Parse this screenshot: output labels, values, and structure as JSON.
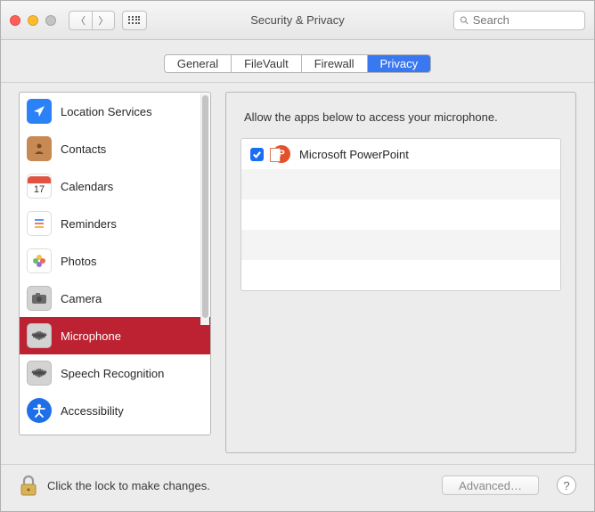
{
  "window": {
    "title": "Security & Privacy"
  },
  "search": {
    "placeholder": "Search",
    "value": ""
  },
  "tabs": [
    {
      "label": "General"
    },
    {
      "label": "FileVault"
    },
    {
      "label": "Firewall"
    },
    {
      "label": "Privacy",
      "active": true
    }
  ],
  "sidebar": {
    "items": [
      {
        "label": "Location Services",
        "icon": "location-icon"
      },
      {
        "label": "Contacts",
        "icon": "contacts-icon"
      },
      {
        "label": "Calendars",
        "icon": "calendar-icon",
        "calendar_day": "17"
      },
      {
        "label": "Reminders",
        "icon": "reminders-icon"
      },
      {
        "label": "Photos",
        "icon": "photos-icon"
      },
      {
        "label": "Camera",
        "icon": "camera-icon"
      },
      {
        "label": "Microphone",
        "icon": "microphone-icon",
        "selected": true
      },
      {
        "label": "Speech Recognition",
        "icon": "speech-icon"
      },
      {
        "label": "Accessibility",
        "icon": "accessibility-icon"
      }
    ]
  },
  "detail": {
    "heading": "Allow the apps below to access your microphone.",
    "apps": [
      {
        "name": "Microsoft PowerPoint",
        "checked": true,
        "icon_letter": "P"
      }
    ]
  },
  "footer": {
    "lock_text": "Click the lock to make changes.",
    "advanced_label": "Advanced…"
  }
}
